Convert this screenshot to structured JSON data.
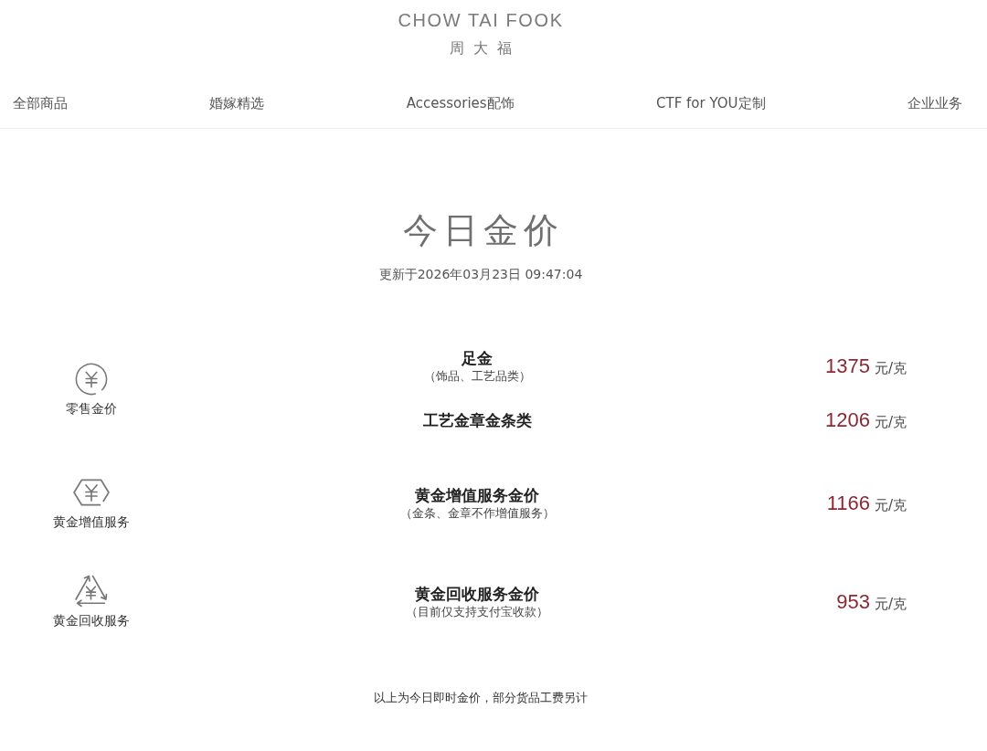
{
  "brand": {
    "wordmark": "CHOW TAI FOOK",
    "chinese_name": "周大福"
  },
  "nav": {
    "items": [
      "全部商品",
      "婚嫁精选",
      "Accessories配饰",
      "CTF for YOU定制",
      "企业业务"
    ]
  },
  "heading": {
    "title": "今日金价",
    "updated": "更新于2026年03月23日 09:47:04"
  },
  "price_groups": [
    {
      "kind": "retail",
      "label": "零售金价",
      "items": [
        {
          "name": "足金",
          "note": "（饰品、工艺品类）",
          "price": "1375",
          "unit": "元/克"
        },
        {
          "name": "工艺金章金条类",
          "price": "1206",
          "unit": "元/克"
        }
      ]
    },
    {
      "kind": "value_added",
      "label": "黄金增值服务",
      "items": [
        {
          "name": "黄金增值服务金价",
          "note": "（金条、金章不作增值服务）",
          "price": "1166",
          "unit": "元/克"
        }
      ]
    },
    {
      "kind": "recycle",
      "label": "黄金回收服务",
      "items": [
        {
          "name": "黄金回收服务金价",
          "note": "（目前仅支持支付宝收款）",
          "price": "953",
          "unit": "元/克"
        }
      ]
    }
  ],
  "footnote": "以上为今日即时金价，部分货品工费另计"
}
